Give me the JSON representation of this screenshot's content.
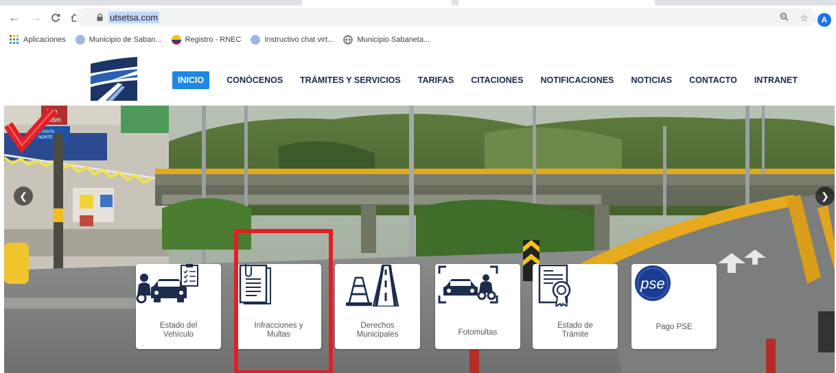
{
  "browser": {
    "url": "utsetsa.com",
    "nav_icons": [
      "back-arrow-icon",
      "forward-arrow-icon",
      "reload-icon",
      "home-icon"
    ],
    "omnibox_icons": [
      "zoom-icon",
      "star-icon"
    ],
    "profile_initial": "A",
    "bookmarks": [
      {
        "label": "Aplicaciones",
        "icon": "apps-grid-icon",
        "color": "#f4b400"
      },
      {
        "label": "Municipio de Saban...",
        "icon": "site-icon",
        "color": "#9bb8df"
      },
      {
        "label": "Registro - RNEC",
        "icon": "rnec-icon",
        "color": "#f6c300"
      },
      {
        "label": "Instructivo chat virt...",
        "icon": "site-icon",
        "color": "#9bb8df"
      },
      {
        "label": "Municipio Sabaneta...",
        "icon": "globe-icon",
        "color": "#5f6368"
      }
    ]
  },
  "site": {
    "nav": [
      {
        "label": "INICIO",
        "active": true
      },
      {
        "label": "CONÓCENOS",
        "active": false
      },
      {
        "label": "TRÁMITES Y SERVICIOS",
        "active": false
      },
      {
        "label": "TARIFAS",
        "active": false
      },
      {
        "label": "CITACIONES",
        "active": false
      },
      {
        "label": "NOTIFICACIONES",
        "active": false
      },
      {
        "label": "NOTICIAS",
        "active": false
      },
      {
        "label": "CONTACTO",
        "active": false
      },
      {
        "label": "INTRANET",
        "active": false
      }
    ],
    "accent": "#1e88e5",
    "nav_text_color": "#1b2a4a"
  },
  "hero": {
    "tiles": [
      {
        "label": "Estado del\nVehículo",
        "icon": "vehicle-status-icon"
      },
      {
        "label": "Infracciones y\nMultas",
        "icon": "document-icon"
      },
      {
        "label": "Derechos\nMunicipales",
        "icon": "road-cone-icon"
      },
      {
        "label": "Fotomultas",
        "icon": "camera-car-icon"
      },
      {
        "label": "Estado de\nTrámite",
        "icon": "certificate-icon"
      },
      {
        "label": "Pago PSE",
        "icon": "pse-logo-icon"
      }
    ],
    "annotation_color": "#e11f26",
    "scene": {
      "sign_lines": [
        "73a",
        "106m",
        "1 VISITA",
        "NORTE"
      ]
    }
  }
}
